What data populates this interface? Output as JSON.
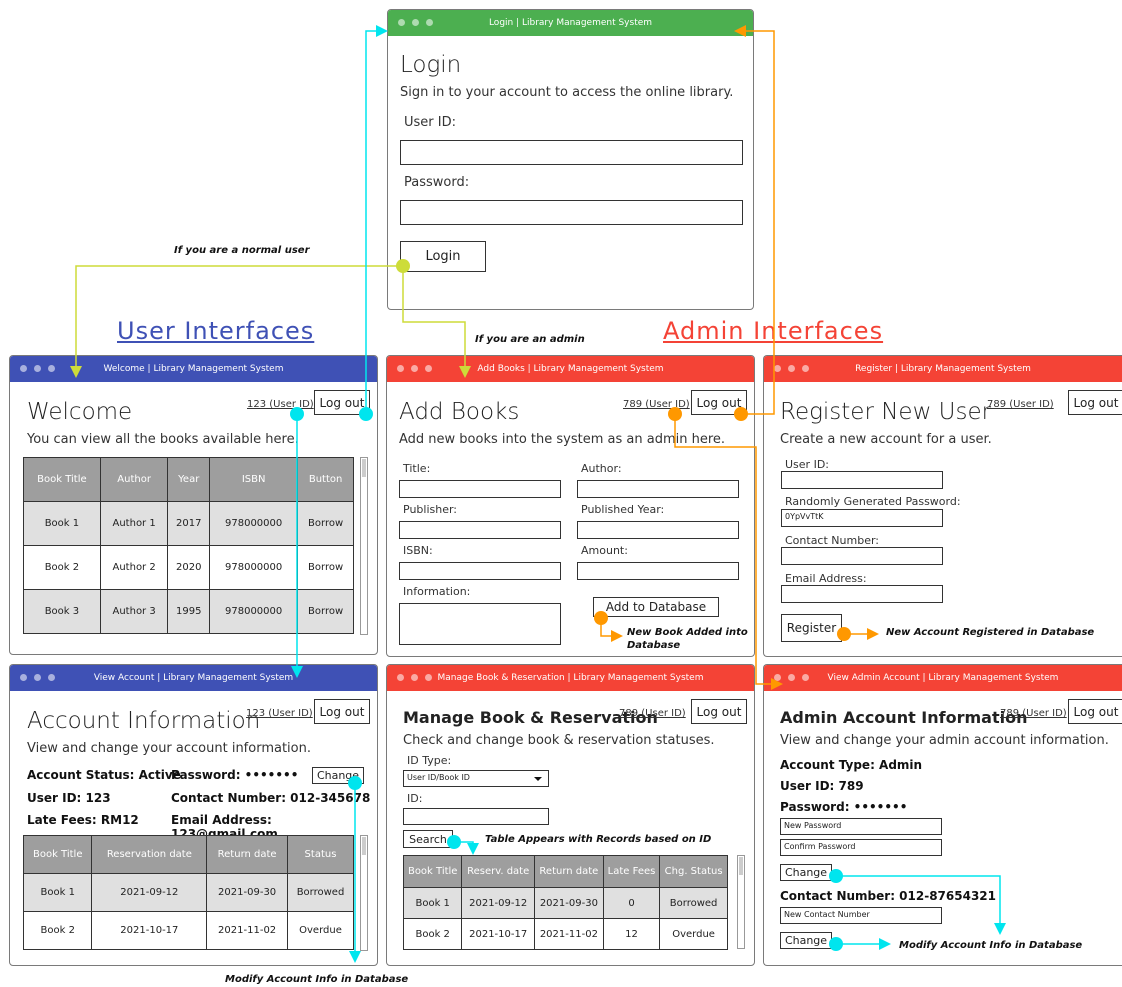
{
  "sections": {
    "user": "User Interfaces",
    "admin": "Admin Interfaces"
  },
  "colors": {
    "user_section": "#3f51b5",
    "admin_section": "#f44336",
    "green": "#4caf50",
    "lime": "#cddc39",
    "cyan": "#00e5ee",
    "orange": "#ff9800"
  },
  "notes": {
    "normal_user": "If you are a normal user",
    "admin": "If you are an admin",
    "new_book_line1": "New Book Added into",
    "new_book_line2": "Database",
    "new_account": "New Account Registered in Database",
    "table_appears": "Table Appears with Records based on ID",
    "modify_account_admin": "Modify Account Info in Database",
    "modify_account_user": "Modify Account Info in Database"
  },
  "login": {
    "title_bar": "Login | Library Management System",
    "heading": "Login",
    "subtitle": "Sign in to your account to access the online library.",
    "user_id_label": "User ID:",
    "password_label": "Password:",
    "login_button": "Login"
  },
  "welcome": {
    "title_bar": "Welcome | Library Management System",
    "heading": "Welcome",
    "user_id": "123 (User ID)",
    "logout": "Log out",
    "subtitle": "You can view all the books available here.",
    "columns": [
      "Book Title",
      "Author",
      "Year",
      "ISBN",
      "Button"
    ],
    "rows": [
      [
        "Book 1",
        "Author 1",
        "2017",
        "978000000",
        "Borrow"
      ],
      [
        "Book 2",
        "Author 2",
        "2020",
        "978000000",
        "Borrow"
      ],
      [
        "Book 3",
        "Author 3",
        "1995",
        "978000000",
        "Borrow"
      ]
    ]
  },
  "add_books": {
    "title_bar": "Add Books | Library Management System",
    "heading": "Add Books",
    "user_id": "789 (User ID)",
    "logout": "Log out",
    "subtitle": "Add new books into the system as an admin here.",
    "title_label": "Title:",
    "author_label": "Author:",
    "publisher_label": "Publisher:",
    "published_year_label": "Published Year:",
    "isbn_label": "ISBN:",
    "amount_label": "Amount:",
    "information_label": "Information:",
    "add_button": "Add to Database"
  },
  "register": {
    "title_bar": "Register | Library Management System",
    "heading": "Register New User",
    "user_id": "789 (User ID)",
    "logout": "Log out",
    "subtitle": "Create a new account for a user.",
    "user_id_label": "User ID:",
    "password_label": "Randomly Generated Password:",
    "password_value": "0YpVvTtK",
    "contact_label": "Contact Number:",
    "email_label": "Email Address:",
    "register_button": "Register"
  },
  "view_account": {
    "title_bar": "View Account | Library Management System",
    "heading": "Account Information",
    "user_id": "123 (User ID)",
    "logout": "Log out",
    "subtitle": "View and change your account information.",
    "status": "Account Status: Active",
    "password": "Password: •••••••",
    "change": "Change",
    "uid": "User ID: 123",
    "contact": "Contact Number: 012-345678",
    "late_fees": "Late Fees: RM12",
    "email": "Email Address: 123@gmail.com",
    "columns": [
      "Book Title",
      "Reservation date",
      "Return date",
      "Status"
    ],
    "rows": [
      [
        "Book 1",
        "2021-09-12",
        "2021-09-30",
        "Borrowed"
      ],
      [
        "Book 2",
        "2021-10-17",
        "2021-11-02",
        "Overdue"
      ]
    ]
  },
  "manage": {
    "title_bar": "Manage Book & Reservation | Library Management System",
    "heading": "Manage Book & Reservation",
    "user_id": "789 (User ID)",
    "logout": "Log out",
    "subtitle": "Check and change book & reservation statuses.",
    "id_type_label": "ID Type:",
    "id_type_value": "User ID/Book ID",
    "id_label": "ID:",
    "search": "Search",
    "columns": [
      "Book Title",
      "Reserv. date",
      "Return date",
      "Late Fees",
      "Chg. Status"
    ],
    "rows": [
      [
        "Book 1",
        "2021-09-12",
        "2021-09-30",
        "0",
        "Borrowed"
      ],
      [
        "Book 2",
        "2021-10-17",
        "2021-11-02",
        "12",
        "Overdue"
      ]
    ]
  },
  "admin_account": {
    "title_bar": "View Admin Account | Library Management System",
    "heading": "Admin Account Information",
    "user_id": "789 (User ID)",
    "logout": "Log out",
    "subtitle": "View and change your admin account information.",
    "type": "Account Type: Admin",
    "uid": "User ID: 789",
    "password": "Password: •••••••",
    "new_password": "New Password",
    "confirm_password": "Confirm Password",
    "change1": "Change",
    "contact": "Contact Number: 012-87654321",
    "new_contact": "New Contact Number",
    "change2": "Change"
  }
}
